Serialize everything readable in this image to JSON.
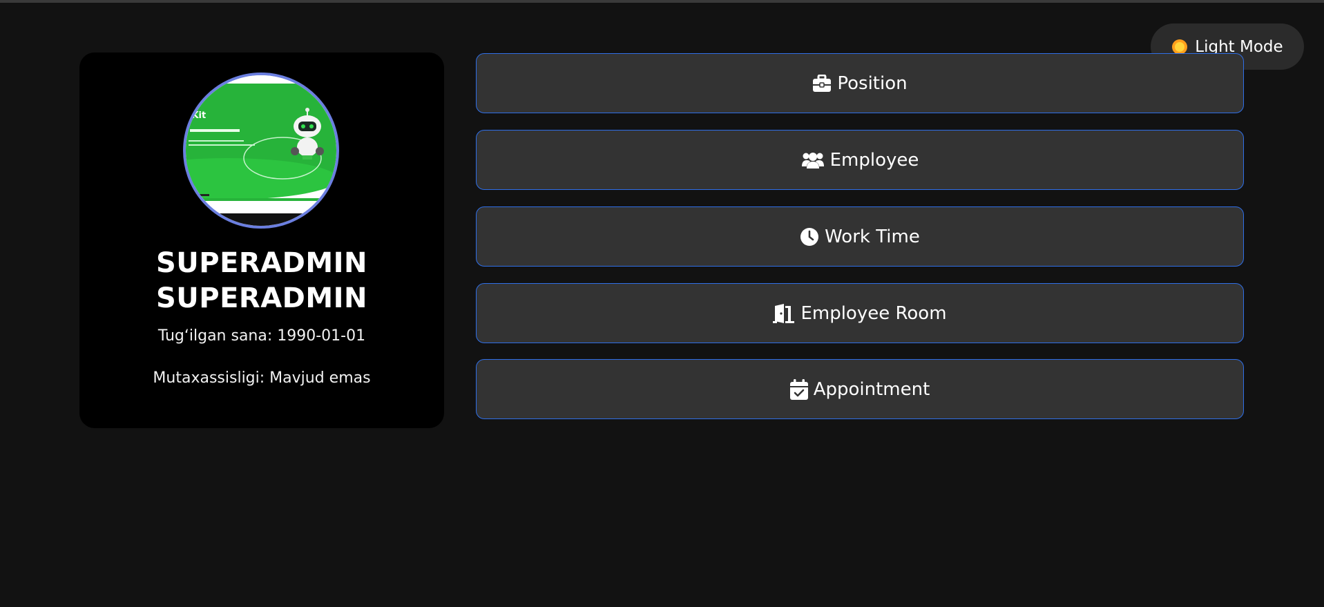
{
  "theme_toggle": {
    "label": "Light Mode",
    "icon": "sun-icon"
  },
  "profile": {
    "first_name": "SUPERADMIN",
    "last_name": "SUPERADMIN",
    "birth_line": "Tug‘ilgan sana: 1990-01-01",
    "specialty_line": "Mutaxassisligi: Mavjud emas",
    "avatar_border_color": "#6b7fe0"
  },
  "menu": {
    "items": [
      {
        "label": "Position",
        "icon": "briefcase-icon"
      },
      {
        "label": "Employee",
        "icon": "users-icon"
      },
      {
        "label": "Work Time",
        "icon": "clock-icon"
      },
      {
        "label": "Employee Room",
        "icon": "door-open-icon"
      },
      {
        "label": "Appointment",
        "icon": "calendar-check-icon"
      }
    ],
    "border_color": "#2f6fe8",
    "background_color": "#333333"
  },
  "colors": {
    "page_background": "#121212",
    "card_background": "#000000"
  }
}
